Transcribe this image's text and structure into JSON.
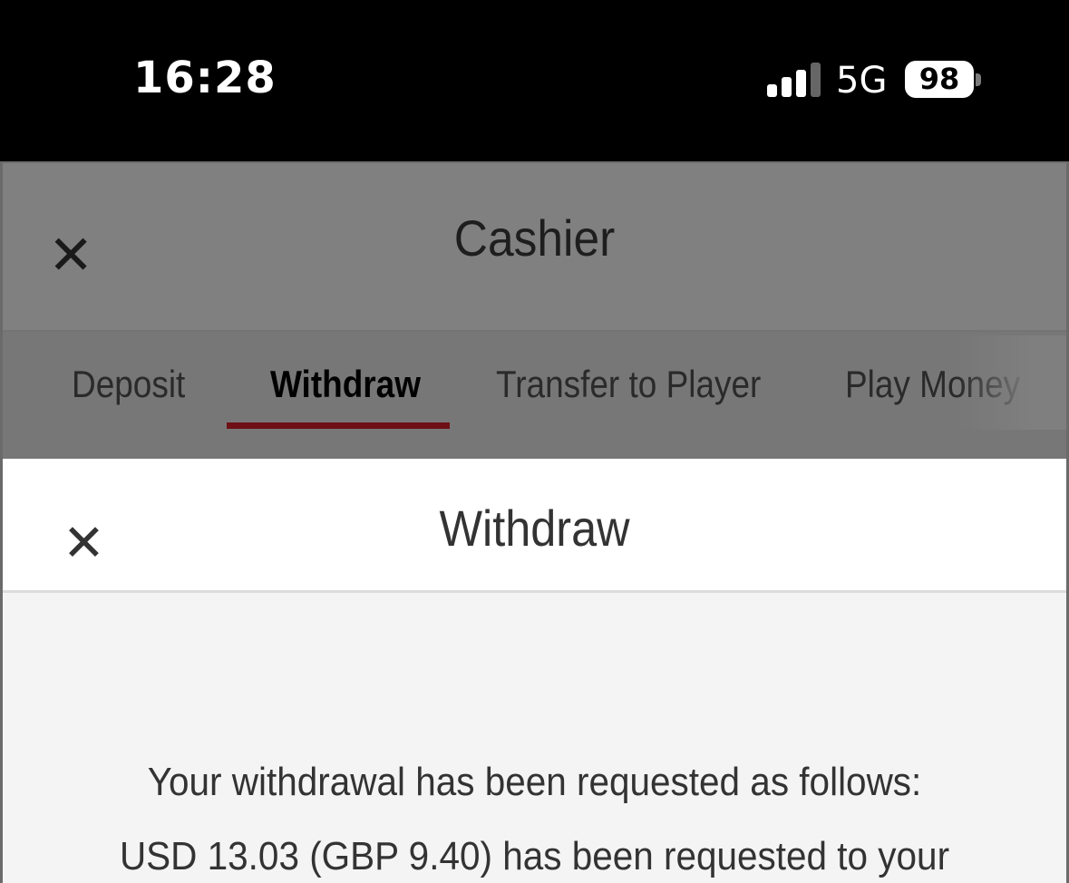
{
  "status_bar": {
    "time": "16:28",
    "network": "5G",
    "battery": "98"
  },
  "cashier": {
    "title": "Cashier",
    "tabs": [
      {
        "label": "Deposit",
        "active": false
      },
      {
        "label": "Withdraw",
        "active": true
      },
      {
        "label": "Transfer to Player",
        "active": false
      },
      {
        "label": "Play Money",
        "active": false
      }
    ],
    "accent_color": "#6e1016"
  },
  "modal": {
    "title": "Withdraw",
    "message_lines": [
      "Your withdrawal has been requested as follows:",
      "USD 13.03 (GBP 9.40) has been requested to your"
    ]
  },
  "icons": {
    "close": "close-icon",
    "signal": "signal-icon",
    "battery": "battery-icon"
  }
}
